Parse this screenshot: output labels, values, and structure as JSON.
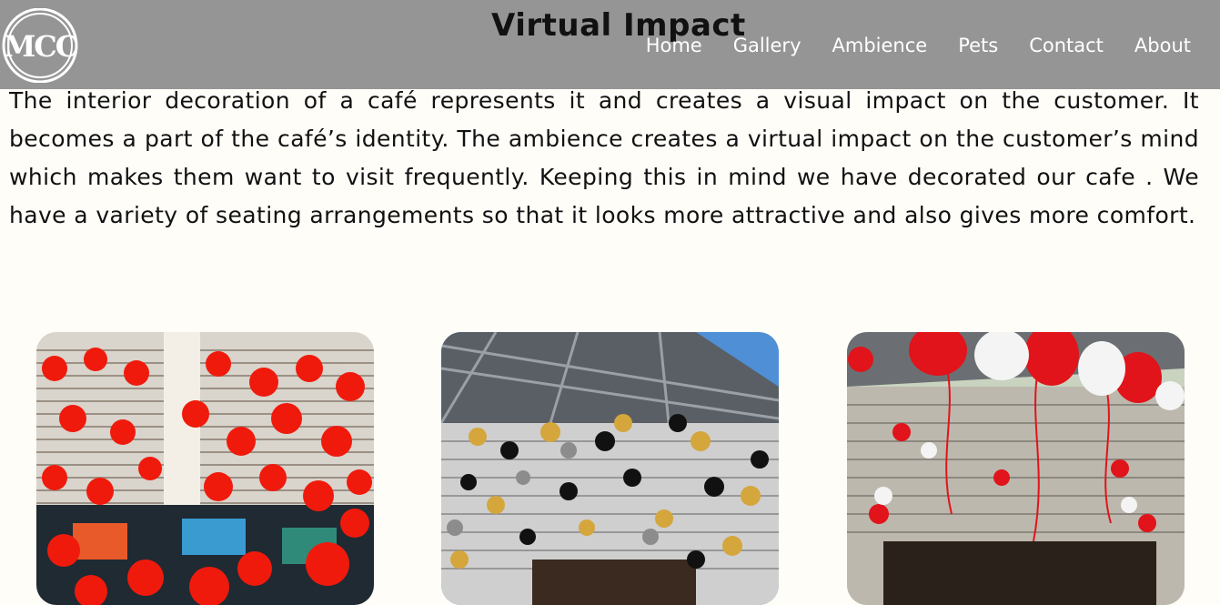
{
  "header": {
    "logo_text": "MCC",
    "title": "Virtual Impact",
    "nav": [
      "Home",
      "Gallery",
      "Ambience",
      "Pets",
      "Contact",
      "About"
    ]
  },
  "intro": {
    "text": "The interior decoration of a café represents it and creates a visual impact on the customer. It becomes a part of the café’s identity. The ambience creates a virtual impact on the customer’s mind which makes them want to visit frequently. Keeping this in mind we have decorated our cafe . We have a variety of seating arrangements so that it looks more attractive and also gives more comfort."
  },
  "colors": {
    "header_bg": "#959595",
    "page_bg": "#fffdf8",
    "nav_text": "#ffffff"
  },
  "gallery": {
    "images": [
      {
        "name": "red-heart-balloons-photo",
        "balloon_colors": [
          "#e8190e",
          "#ff2a1a"
        ]
      },
      {
        "name": "black-gold-balloons-photo",
        "balloon_colors": [
          "#111111",
          "#d4a63c",
          "#8c8c8c"
        ]
      },
      {
        "name": "red-white-balloons-photo",
        "balloon_colors": [
          "#e0141a",
          "#f4f4f4"
        ]
      }
    ]
  }
}
